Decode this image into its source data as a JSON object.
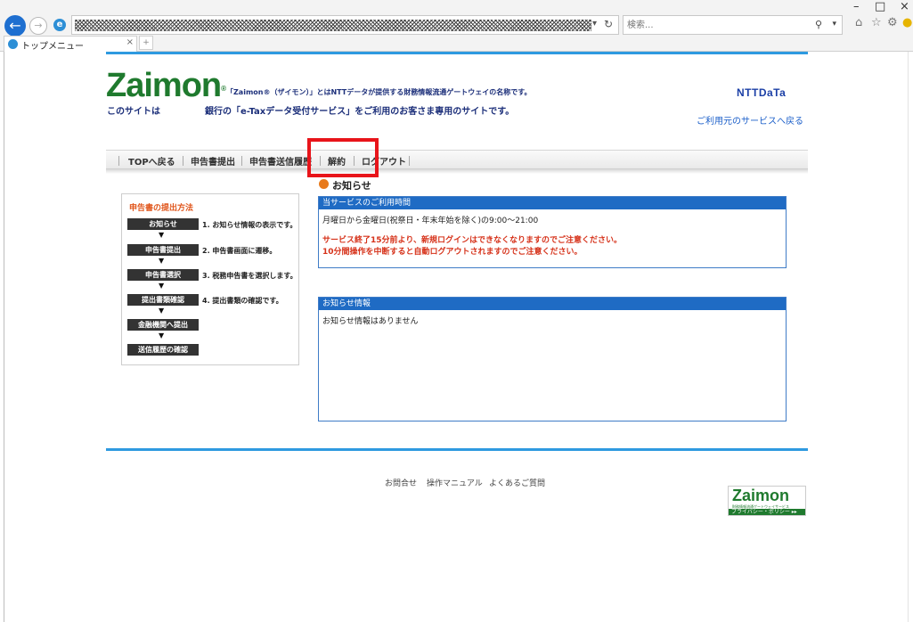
{
  "browser": {
    "address_value": "",
    "search_placeholder": "検索...",
    "tab_title": "トップメニュー",
    "tab_close": "×",
    "back_glyph": "←",
    "forward_glyph": "→",
    "refresh_glyph": "↻",
    "dropdown_glyph": "▾",
    "search_glyph": "⚲",
    "home_glyph": "⌂",
    "favorites_glyph": "☆",
    "settings_glyph": "⚙",
    "minimize_glyph": "–",
    "maximize_glyph": "□",
    "close_glyph": "×"
  },
  "header": {
    "logo_text": "Zaimon",
    "logo_mark": "®",
    "tagline": "「Zaimon®（ザイモン）」とはNTTデータが提供する財務情報流通ゲートウェイの名称です。",
    "site_desc_prefix": "このサイトは",
    "site_desc_body": "銀行の「e-Taxデータ受付サービス」をご利用のお客さま専用のサイトです。",
    "ntt_logo": "NTTDaTa",
    "return_link": "ご利用元のサービスへ戻る"
  },
  "nav": {
    "items": [
      "TOPへ戻る",
      "申告書提出",
      "申告書送信履歴",
      "解約",
      "ログアウト"
    ]
  },
  "notice_heading": "お知らせ",
  "steps": {
    "title": "申告書の提出方法",
    "items": [
      {
        "label": "お知らせ",
        "desc": "1. お知らせ情報の表示です。"
      },
      {
        "label": "申告書提出",
        "desc": "2. 申告書画面に遷移。"
      },
      {
        "label": "申告書選択",
        "desc": "3. 税務申告書を選択します。"
      },
      {
        "label": "提出書類確認",
        "desc": "4. 提出書類の確認です。"
      },
      {
        "label": "金融機関へ提出",
        "desc": ""
      },
      {
        "label": "送信履歴の確認",
        "desc": ""
      }
    ],
    "arrow": "▼"
  },
  "service_panel": {
    "title": "当サービスのご利用時間",
    "hours": "月曜日から金曜日(祝祭日・年末年始を除く)の9:00〜21:00",
    "warning1": "サービス終了15分前より、新規ログインはできなくなりますのでご注意ください。",
    "warning2": "10分間操作を中断すると自動ログアウトされますのでご注意ください。"
  },
  "info_panel": {
    "title": "お知らせ情報",
    "body": "お知らせ情報はありません"
  },
  "footer": {
    "links": [
      "お問合せ",
      "操作マニュアル",
      "よくあるご質問"
    ],
    "badge_logo": "Zaimon",
    "badge_sub": "財務情報流通ゲートウェイサービス",
    "badge_bar": "プライバシー・ポリシー ▸▸"
  },
  "colors": {
    "accent_blue": "#2e9ae0",
    "panel_blue": "#1f6bc4",
    "brand_green": "#1f7a2e",
    "warning_red": "#d6321a",
    "highlight_red": "#e8141a",
    "step_title_orange": "#e0561c"
  }
}
